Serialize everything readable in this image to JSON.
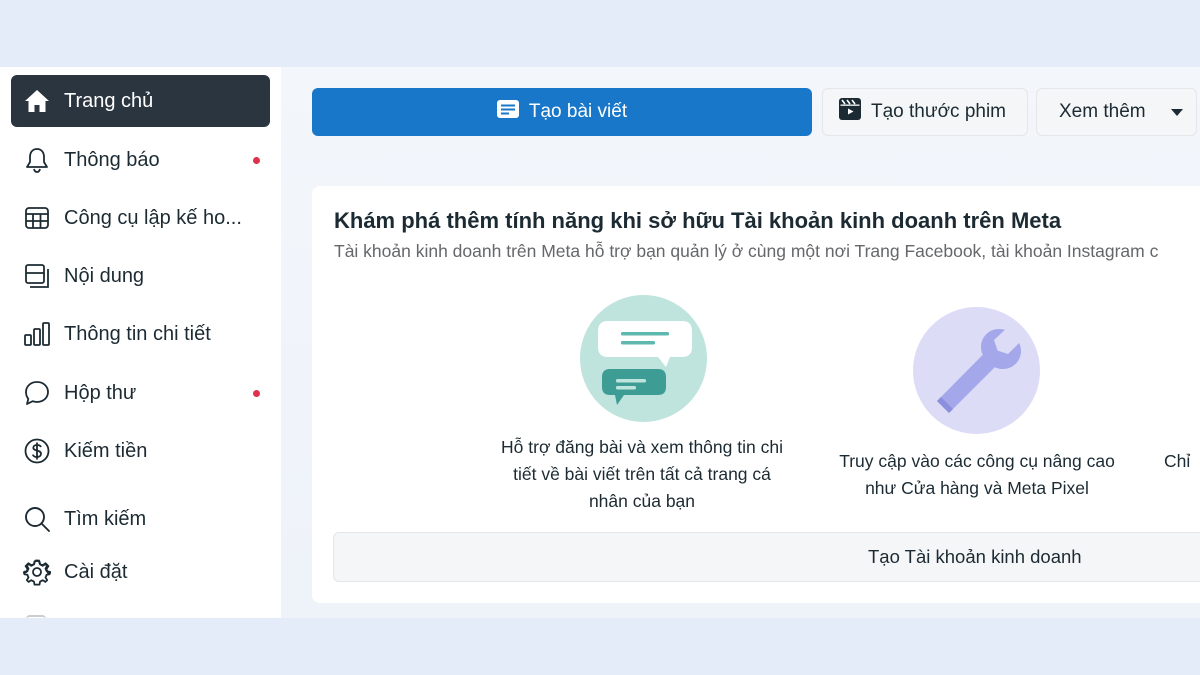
{
  "sidebar": {
    "items": [
      {
        "label": "Trang chủ",
        "icon": "home-icon",
        "active": true,
        "badge": false
      },
      {
        "label": "Thông báo",
        "icon": "bell-icon",
        "active": false,
        "badge": true
      },
      {
        "label": "Công cụ lập kế ho...",
        "icon": "calendar-grid-icon",
        "active": false,
        "badge": false
      },
      {
        "label": "Nội dung",
        "icon": "content-icon",
        "active": false,
        "badge": false
      },
      {
        "label": "Thông tin chi tiết",
        "icon": "bar-chart-icon",
        "active": false,
        "badge": false
      },
      {
        "label": "Hộp thư",
        "icon": "chat-bubble-icon",
        "active": false,
        "badge": true
      },
      {
        "label": "Kiếm tiền",
        "icon": "dollar-circle-icon",
        "active": false,
        "badge": false
      },
      {
        "label": "Tìm kiếm",
        "icon": "search-icon",
        "active": false,
        "badge": false
      },
      {
        "label": "Cài đặt",
        "icon": "gear-icon",
        "active": false,
        "badge": false
      }
    ],
    "badge_color": "#e0314b"
  },
  "toolbar": {
    "create_post_label": "Tạo bài viết",
    "create_reel_label": "Tạo thước phim",
    "more_label": "Xem thêm"
  },
  "card": {
    "title": "Khám phá thêm tính năng khi sở hữu Tài khoản kinh doanh trên Meta",
    "subtitle": "Tài khoản kinh doanh trên Meta hỗ trợ bạn quản lý ở cùng một nơi Trang Facebook, tài khoản Instagram c",
    "features": [
      {
        "text": "Hỗ trợ đăng bài và xem thông tin chi tiết về bài viết trên tất cả trang cá nhân của bạn",
        "icon": "chat-bubbles-illustration"
      },
      {
        "text": "Truy cập vào các công cụ nâng cao như Cửa hàng và Meta Pixel",
        "icon": "wrench-illustration"
      },
      {
        "text": "Chỉ"
      }
    ],
    "cta_label": "Tạo Tài khoản kinh doanh"
  },
  "colors": {
    "primary": "#1877c8",
    "active_nav": "#2a353f",
    "background": "#e3ecf8"
  }
}
